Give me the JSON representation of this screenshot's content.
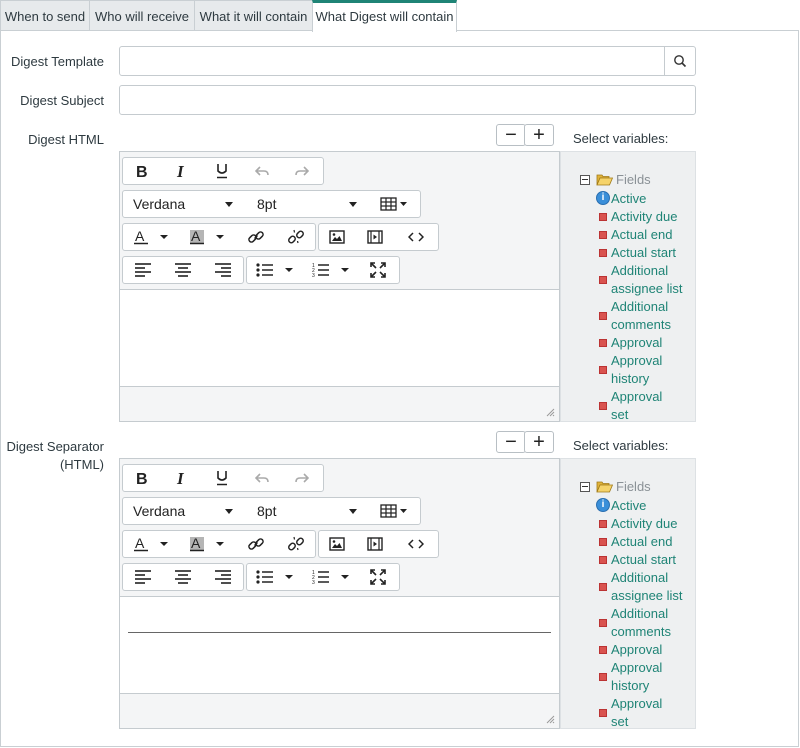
{
  "tabs": [
    {
      "label": "When to send"
    },
    {
      "label": "Who will receive"
    },
    {
      "label": "What it will contain"
    },
    {
      "label": "What Digest will contain"
    }
  ],
  "form": {
    "digest_template_label": "Digest Template",
    "digest_template_value": "",
    "digest_subject_label": "Digest Subject",
    "digest_subject_value": "",
    "digest_html_label": "Digest HTML",
    "digest_separator_label_line1": "Digest Separator",
    "digest_separator_label_line2": "(HTML)"
  },
  "editor": {
    "font_name": "Verdana",
    "font_size": "8pt"
  },
  "variables": {
    "title": "Select variables:",
    "root_label": "Fields",
    "items": [
      {
        "line1": "Active",
        "line2": ""
      },
      {
        "line1": "Activity due",
        "line2": ""
      },
      {
        "line1": "Actual end",
        "line2": ""
      },
      {
        "line1": "Actual start",
        "line2": ""
      },
      {
        "line1": "Additional",
        "line2": "assignee list"
      },
      {
        "line1": "Additional",
        "line2": "comments"
      },
      {
        "line1": "Approval",
        "line2": ""
      },
      {
        "line1": "Approval",
        "line2": "history"
      },
      {
        "line1": "Approval",
        "line2": "set"
      }
    ]
  },
  "colors": {
    "accent": "#1f8476",
    "tab_bg": "#e7eaec",
    "border": "#c5cbcf"
  }
}
